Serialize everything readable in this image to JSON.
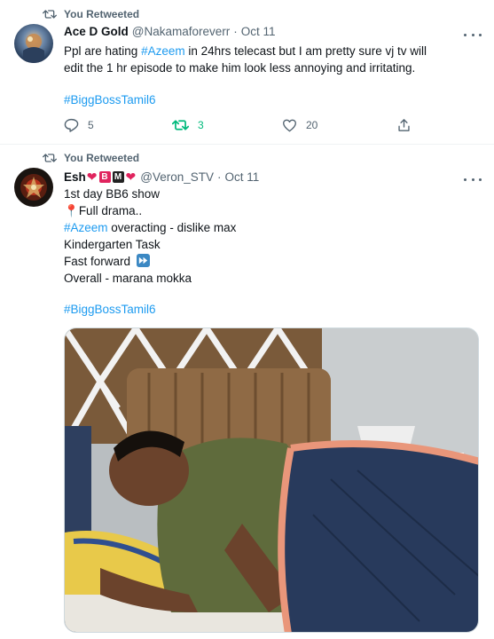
{
  "tweets": [
    {
      "retweet_label": "You Retweeted",
      "name": "Ace D Gold",
      "handle": "@Nakamaforeverr",
      "sep": "·",
      "time": "Oct 11",
      "text_pre": "Ppl are hating ",
      "text_tag": "#Azeem",
      "text_post": " in 24hrs telecast but I am pretty sure vj tv will edit the 1 hr episode to make him look less annoying and irritating.",
      "hashtag": "#BiggBossTamil6",
      "replies": "5",
      "retweets": "3",
      "likes": "20"
    },
    {
      "retweet_label": "You Retweeted",
      "name": "Esh",
      "badge_b": "B",
      "badge_m": "M",
      "handle": "@Veron_STV",
      "sep": "·",
      "time": "Oct 11",
      "line1": "1st day BB6 show",
      "line2": "Full drama..",
      "line3_tag": "#Azeem",
      "line3_rest": " overacting - dislike max",
      "line4": "Kindergarten Task",
      "line5": "Fast forward",
      "line6": "Overall - marana mokka",
      "hashtag": "#BiggBossTamil6",
      "media_alt": "Man lying on a bed under a navy quilt, leaning on an elbow"
    }
  ],
  "colors": {
    "accent": "#1d9bf0",
    "retweet_active": "#00ba7c",
    "muted": "#536471"
  }
}
